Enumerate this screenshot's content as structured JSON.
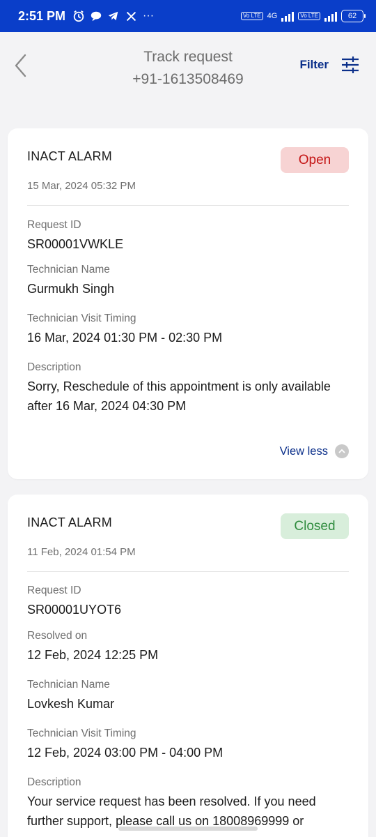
{
  "status_bar": {
    "time": "2:51 PM",
    "net_label": "4G",
    "volte_label": "Vo LTE",
    "battery": "62"
  },
  "header": {
    "title": "Track request",
    "phone": "+91-1613508469",
    "filter_label": "Filter"
  },
  "requests": [
    {
      "service": "INACT ALARM",
      "date": "15 Mar, 2024 05:32 PM",
      "status": "Open",
      "status_color": "#c41414",
      "fields": [
        {
          "label": "Request ID",
          "value": "SR00001VWKLE"
        },
        {
          "label": "Technician Name",
          "value": "Gurmukh Singh"
        },
        {
          "label": "Technician Visit Timing",
          "value": "16 Mar, 2024 01:30 PM - 02:30 PM"
        },
        {
          "label": "Description",
          "value": "Sorry, Reschedule of this appointment is only available after 16 Mar, 2024 04:30 PM"
        }
      ],
      "toggle_label": "View less"
    },
    {
      "service": "INACT ALARM",
      "date": "11 Feb, 2024 01:54 PM",
      "status": "Closed",
      "status_color": "#2f8c3e",
      "fields": [
        {
          "label": "Request ID",
          "value": "SR00001UYOT6"
        },
        {
          "label": "Resolved on",
          "value": "12 Feb, 2024 12:25 PM"
        },
        {
          "label": "Technician Name",
          "value": "Lovkesh Kumar"
        },
        {
          "label": "Technician Visit Timing",
          "value": "12 Feb, 2024 03:00 PM - 04:00 PM"
        },
        {
          "label": "Description",
          "value": "Your service request has been resolved. If you need further support, please call us on 18008969999 or"
        }
      ]
    }
  ]
}
